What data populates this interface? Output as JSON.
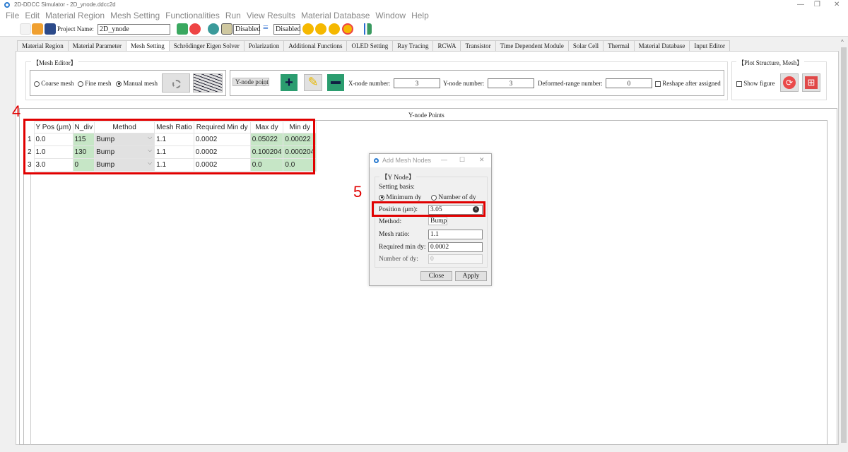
{
  "window": {
    "title": "2D-DDCC Simulator - 2D_ynode.ddcc2d"
  },
  "menu": [
    "File",
    "Edit",
    "Material Region",
    "Mesh Setting",
    "Functionalities",
    "Run",
    "View Results",
    "Material Database",
    "Window",
    "Help"
  ],
  "toolbar": {
    "project_label": "Project Name:",
    "project_name": "2D_ynode",
    "disabled1": "Disabled",
    "disabled2": "Disabled"
  },
  "tabs": [
    "Material Region",
    "Material Parameter",
    "Mesh Setting",
    "Schrödinger Eigen Solver",
    "Polarization",
    "Additional Functions",
    "OLED Setting",
    "Ray Tracing",
    "RCWA",
    "Transistor",
    "Time Dependent Module",
    "Solar Cell",
    "Thermal",
    "Material Database",
    "Input Editor"
  ],
  "active_tab": "Mesh Setting",
  "mesh_editor": {
    "title": "【Mesh Editor】",
    "coarse": "Coarse mesh",
    "fine": "Fine mesh",
    "manual": "Manual mesh",
    "selected": "Manual mesh",
    "node_select": "Y-node point",
    "x_label": "X-node number:",
    "x_value": "3",
    "y_label": "Y-node number:",
    "y_value": "3",
    "def_label": "Deformed-range number:",
    "def_value": "0",
    "reshape_label": "Reshape after assigned",
    "reshape_checked": false
  },
  "plot": {
    "title": "【Plot Structure, Mesh】",
    "show_figure": "Show figure",
    "show_checked": false
  },
  "ynode": {
    "title": "Y-node Points",
    "columns": [
      "Y Pos (μm)",
      "N_div",
      "Method",
      "Mesh Ratio",
      "Required Min dy",
      "Max dy",
      "Min dy"
    ],
    "rows": [
      {
        "n": "1",
        "ypos": "0.0",
        "ndiv": "115",
        "method": "Bump",
        "ratio": "1.1",
        "req": "0.0002",
        "max": "0.05022",
        "min": "0.00022"
      },
      {
        "n": "2",
        "ypos": "1.0",
        "ndiv": "130",
        "method": "Bump",
        "ratio": "1.1",
        "req": "0.0002",
        "max": "0.100204",
        "min": "0.000204"
      },
      {
        "n": "3",
        "ypos": "3.0",
        "ndiv": "0",
        "method": "Bump",
        "ratio": "1.1",
        "req": "0.0002",
        "max": "0.0",
        "min": "0.0"
      }
    ]
  },
  "annotations": {
    "a4": "4",
    "a5": "5",
    "color": "#e00000"
  },
  "dialog": {
    "title": "Add Mesh Nodes",
    "group": "【Y Node】",
    "basis_label": "Setting basis:",
    "opt_min": "Minimum dy",
    "opt_num": "Number of dy",
    "selected": "Minimum dy",
    "position_label": "Position (μm):",
    "position": "3.05",
    "method_label": "Method:",
    "method": "Bump",
    "ratio_label": "Mesh ratio:",
    "ratio": "1.1",
    "req_label": "Required min dy:",
    "req": "0.0002",
    "num_label": "Number of dy:",
    "num": "0",
    "close": "Close",
    "apply": "Apply"
  }
}
